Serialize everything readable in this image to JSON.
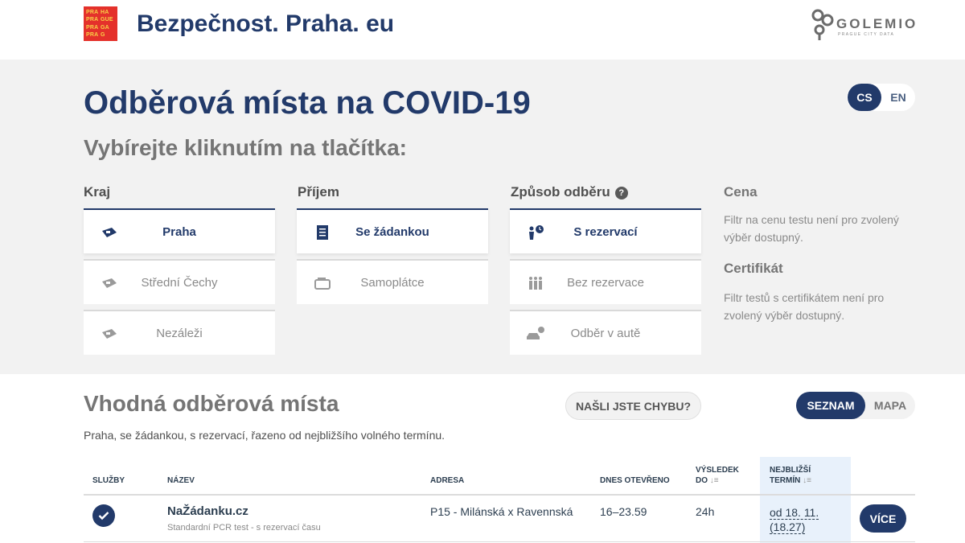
{
  "header": {
    "logo_lines": [
      "PRA",
      "HA",
      "PRA",
      "GUE",
      "PRA",
      "GA",
      "PRA",
      "G"
    ],
    "site_title": "Bezpečnost. Praha. eu",
    "partner_logo": "GOLEMIO",
    "partner_tagline": "PRAGUE CITY DATA"
  },
  "filters": {
    "title": "Odběrová místa na COVID-19",
    "subtitle": "Vybírejte kliknutím na tlačítka:",
    "lang": {
      "cs": "CS",
      "en": "EN",
      "active": "CS"
    },
    "kraj": {
      "label": "Kraj",
      "options": [
        {
          "label": "Praha",
          "icon": "map-region-icon",
          "active": true
        },
        {
          "label": "Střední Čechy",
          "icon": "map-region-icon",
          "active": false
        },
        {
          "label": "Nezáleži",
          "icon": "map-region-icon",
          "active": false
        }
      ]
    },
    "prijem": {
      "label": "Příjem",
      "options": [
        {
          "label": "Se žádankou",
          "icon": "document-icon",
          "active": true
        },
        {
          "label": "Samoplátce",
          "icon": "wallet-icon",
          "active": false
        }
      ]
    },
    "zpusob": {
      "label": "Způsob odběru",
      "help": "?",
      "options": [
        {
          "label": "S rezervací",
          "icon": "person-clock-icon",
          "active": true
        },
        {
          "label": "Bez rezervace",
          "icon": "people-icon",
          "active": false
        },
        {
          "label": "Odběr v autě",
          "icon": "car-clock-icon",
          "active": false
        }
      ]
    },
    "cena": {
      "label": "Cena",
      "text": "Filtr na cenu testu není pro zvolený výběr dostupný."
    },
    "certifikat": {
      "label": "Certifikát",
      "text": "Filtr testů s certifikátem není pro zvolený výběr dostupný."
    }
  },
  "results": {
    "title": "Vhodná odběrová místa",
    "report_button": "NAŠLI JSTE CHYBU?",
    "view": {
      "list": "SEZNAM",
      "map": "MAPA",
      "active": "SEZNAM"
    },
    "description": "Praha, se žádankou, s rezervací, řazeno od nejbližšího volného termínu.",
    "columns": {
      "services": "SLUŽBY",
      "name": "NÁZEV",
      "address": "ADRESA",
      "open_today": "DNES OTEVŘENO",
      "result_by_1": "VÝSLEDEK",
      "result_by_2": "DO",
      "nearest_1": "NEJBLIŽŠÍ",
      "nearest_2": "TERMÍN",
      "sort_icon": "↓≡"
    },
    "rows": [
      {
        "name": "NaŽádanku.cz",
        "subtitle": "Standardní PCR test - s rezervací času",
        "address": "P15 - Milánská x Ravennská",
        "open_today": "16–23.59",
        "result_by": "24h",
        "nearest_1": "od 18. 11.",
        "nearest_2": "(18.27)",
        "more": "VÍCE"
      }
    ]
  },
  "colors": {
    "primary": "#223a6a",
    "praha_red": "#e4312b",
    "praha_yellow": "#f8d047",
    "panel_bg": "#f2f2f2",
    "highlight": "#e8f1fb"
  }
}
